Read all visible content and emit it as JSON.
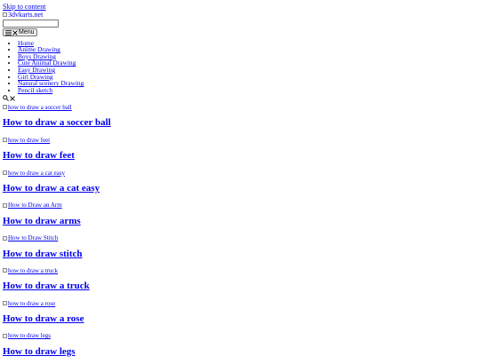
{
  "skip_link": "Skip to content",
  "logo": {
    "alt": "3dvkarts.net"
  },
  "search": {
    "placeholder": "",
    "value": ""
  },
  "menu_button": {
    "label": "Menu",
    "icon": "hamburger-close-icon"
  },
  "nav": {
    "items": [
      {
        "label": "Home"
      },
      {
        "label": "Anime Drawing"
      },
      {
        "label": "Boys Drawing"
      },
      {
        "label": "Cute Animal Drawing"
      },
      {
        "label": "Easy Drawing"
      },
      {
        "label": "Girl Drawing"
      },
      {
        "label": "Natural scenery Drawing"
      },
      {
        "label": "Pencil sketch"
      }
    ]
  },
  "header_icons": [
    "search-icon",
    "close-icon"
  ],
  "posts": [
    {
      "thumb_alt": "how to draw a soccer ball",
      "title": "How to draw a soccer ball"
    },
    {
      "thumb_alt": "how to draw feet",
      "title": "How to draw feet"
    },
    {
      "thumb_alt": "how to draw a cat easy",
      "title": "How to draw a cat easy"
    },
    {
      "thumb_alt": "How to Draw an Arm",
      "title": "How to draw arms"
    },
    {
      "thumb_alt": "How to Draw Stitch",
      "title": "How to draw stitch"
    },
    {
      "thumb_alt": "how to draw a truck",
      "title": "How to draw a truck"
    },
    {
      "thumb_alt": "how to draw a rose",
      "title": "How to draw a rose"
    },
    {
      "thumb_alt": "how to draw legs",
      "title": "How to draw legs"
    }
  ],
  "colors": {
    "link": "#0000ee",
    "text": "#000000",
    "background": "#ffffff"
  }
}
